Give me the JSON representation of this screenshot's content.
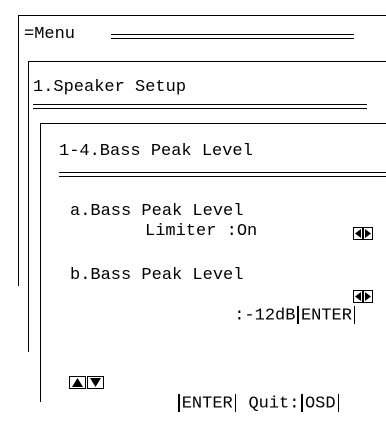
{
  "menu": {
    "root_title": "=Menu",
    "level1_title": "1.Speaker Setup",
    "level2_title": "1-4.Bass Peak Level"
  },
  "items": [
    {
      "label_line1": "a.Bass Peak Level",
      "label_line2": "Limiter :On"
    },
    {
      "label_line1": "b.Bass Peak Level",
      "value": ":-12dB",
      "enter": "ENTER"
    }
  ],
  "footer": {
    "enter": "ENTER",
    "quit": "Quit:",
    "osd": "OSD"
  },
  "icons": {
    "left_right": "left-right-arrows-icon",
    "up_down": "up-down-arrows-icon"
  }
}
